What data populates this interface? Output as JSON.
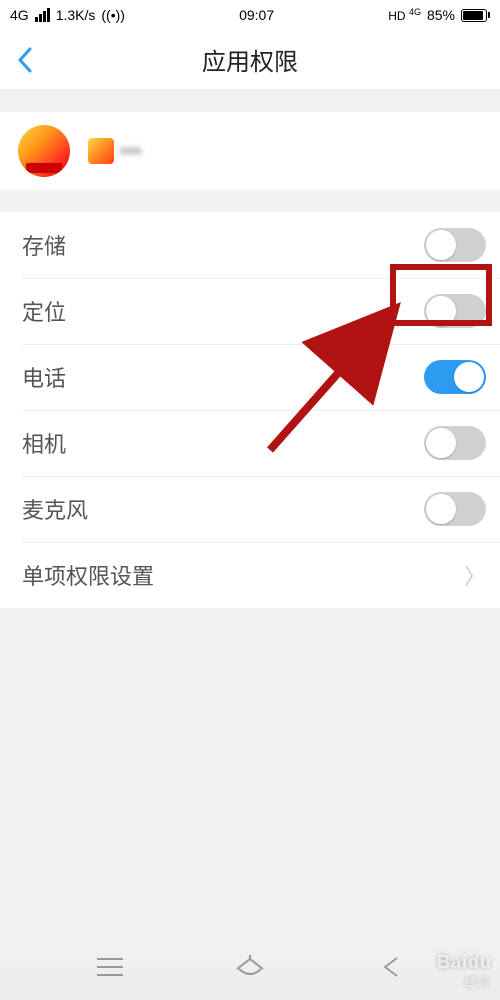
{
  "status": {
    "network": "4G",
    "speed": "1.3K/s",
    "time": "09:07",
    "hd4g": "HD",
    "net_badge": "4G",
    "battery_pct": "85%"
  },
  "header": {
    "title": "应用权限"
  },
  "app": {
    "name": "▪▪▪"
  },
  "permissions": [
    {
      "label": "存储",
      "on": false
    },
    {
      "label": "定位",
      "on": false
    },
    {
      "label": "电话",
      "on": true
    },
    {
      "label": "相机",
      "on": false
    },
    {
      "label": "麦克风",
      "on": false
    }
  ],
  "detail_row": {
    "label": "单项权限设置"
  },
  "watermark": {
    "brand": "Baidu",
    "sub": "经验"
  }
}
